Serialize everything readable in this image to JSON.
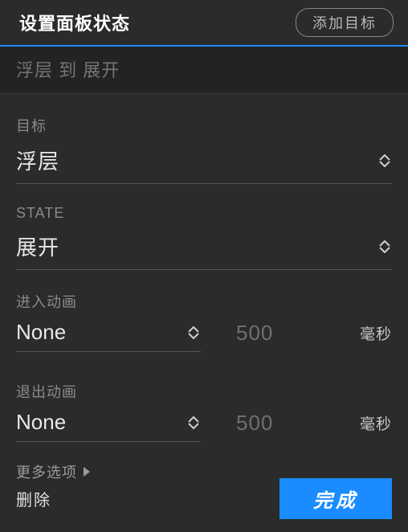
{
  "header": {
    "title": "设置面板状态",
    "add_target": "添加目标"
  },
  "summary": "浮层 到 展开",
  "target": {
    "label": "目标",
    "value": "浮层"
  },
  "state": {
    "label": "STATE",
    "value": "展开"
  },
  "enter_anim": {
    "label": "进入动画",
    "value": "None",
    "duration": "500",
    "unit": "毫秒"
  },
  "exit_anim": {
    "label": "退出动画",
    "value": "None",
    "duration": "500",
    "unit": "毫秒"
  },
  "more_options": "更多选项",
  "footer": {
    "delete": "删除",
    "done": "完成"
  }
}
